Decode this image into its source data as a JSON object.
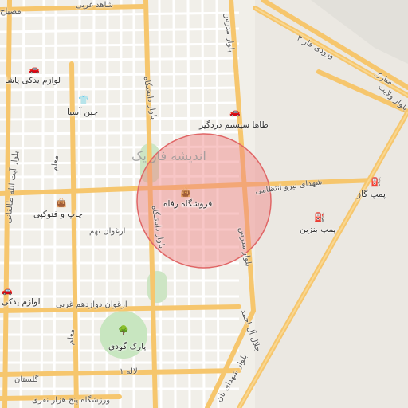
{
  "colors": {
    "background": "#f1efe9",
    "road_major": "#f6c66d",
    "road_minor": "#ffffff",
    "highlight_fill": "#f08080",
    "highlight_stroke": "#e06666",
    "park": "#c8e6c0"
  },
  "labels": {
    "shahed_west": "شاهد غربی",
    "blvd_modares_top": "بلوار مدرس",
    "freeway_3": "ورودی فاز ۳",
    "marik": "مبارک",
    "blvd_velayat": "بلوار ولایت",
    "lavazem_pashah": "لوازم یدکی پاشا",
    "jin_asia": "جین آسیا",
    "taha_system": "طاها سیستم دزدگیر",
    "blvd_danesh": "بلوار دانشگاه",
    "andishe_area": "اندیشه\nفاز یک",
    "shohada_niroo": "شهدای نیرو انتظامی",
    "pump_gas": "پمپ گاز",
    "forushgah_refah": "فروشگاه رفاه",
    "chap_fotokopi": "چاپ و فتوکپی",
    "pump_benzin": "پمپ بنزین",
    "arghavan_nohom": "ارغوان نهم",
    "blvd_modares_mid": "بلوار مدرس",
    "lavazem_yadaki": "لوازم یدکی",
    "arghavan_12": "ارغوان دوازدهم غربی",
    "jalal_ale_ahmad": "جلال آل احمد",
    "park_goudi": "پارک گودی",
    "lale_1": "لاله ۱",
    "blvd_shohada": "بلوار شهدای نان",
    "golestan": "گلستان",
    "varzeshgah": "ورزشگاه پنج هزار نفری",
    "ayatollah_taleghani": "بلوار آیت الله طالقانی",
    "moalem": "معلم",
    "mesbah": "مصباح"
  },
  "icons": {
    "car": "car-icon",
    "shirt": "shirt-icon",
    "bag": "shopping-bag-icon",
    "fuel": "fuel-pump-icon",
    "tree": "park-tree-icon"
  }
}
